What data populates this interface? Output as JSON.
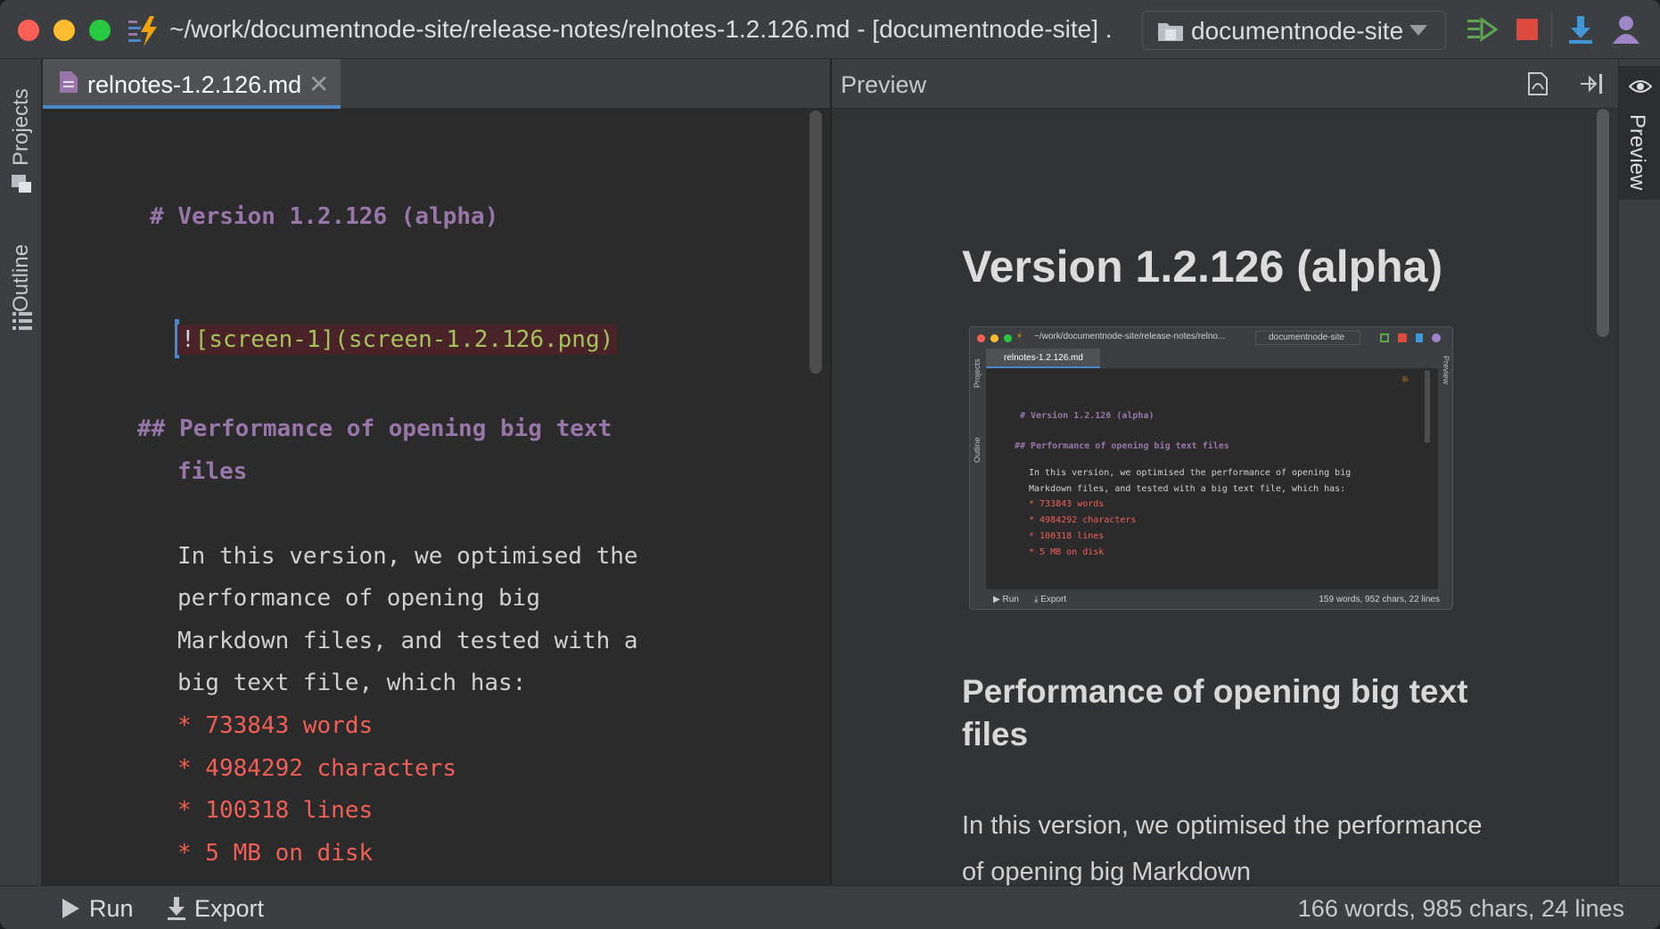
{
  "window": {
    "title": "~/work/documentnode-site/release-notes/relnotes-1.2.126.md - [documentnode-site] ...",
    "project_selector": "documentnode-site"
  },
  "colors": {
    "accent": "#4a88c7",
    "heading": "#9876aa",
    "list_item": "#f15f56",
    "image_link": "#a5c25c",
    "run": "#5fa453",
    "stop": "#db4a3c"
  },
  "toolbar": {
    "icons": [
      "run-icon",
      "stop-icon",
      "download-icon",
      "user-icon"
    ]
  },
  "left_tools": {
    "projects": "Projects",
    "outline": "Outline"
  },
  "right_tools": {
    "preview": "Preview"
  },
  "editor": {
    "tab_label": "relnotes-1.2.126.md",
    "h1_marker": "#",
    "h1_text": "Version 1.2.126 (alpha)",
    "image_bang": "!",
    "image_link": "[screen-1](screen-1.2.126.png)",
    "h2_marker": "##",
    "h2_line1": "Performance of opening big text",
    "h2_line2": "files",
    "para_lines": [
      "In this version, we optimised the",
      "performance of opening big",
      "Markdown files, and tested with a",
      "big text file, which has:"
    ],
    "list_items": [
      "* 733843 words",
      "* 4984292 characters",
      "* 100318 lines",
      "* 5 MB on disk"
    ]
  },
  "preview": {
    "header": "Preview",
    "h1": "Version 1.2.126 (alpha)",
    "h2": "Performance of opening big text files",
    "paragraph": "In this version, we optimised the performance of opening big Markdown",
    "thumbnail": {
      "title": "~/work/documentnode-site/release-notes/relno...",
      "project": "documentnode-site",
      "tab": "relnotes-1.2.126.md",
      "projects": "Projects",
      "outline": "Outline",
      "preview": "Preview",
      "h1": "# Version 1.2.126 (alpha)",
      "h2": "## Performance of opening big text files",
      "para1": "In this version, we optimised the performance of opening big",
      "para2": "Markdown files, and tested with a big text file, which has:",
      "items": [
        "* 733843 words",
        "* 4984292 characters",
        "* 100318 lines",
        "* 5 MB on disk"
      ],
      "run": "Run",
      "export": "Export",
      "stats": "159 words, 952 chars, 22 lines"
    }
  },
  "statusbar": {
    "run": "Run",
    "export": "Export",
    "stats": "166 words, 985 chars, 24 lines"
  }
}
